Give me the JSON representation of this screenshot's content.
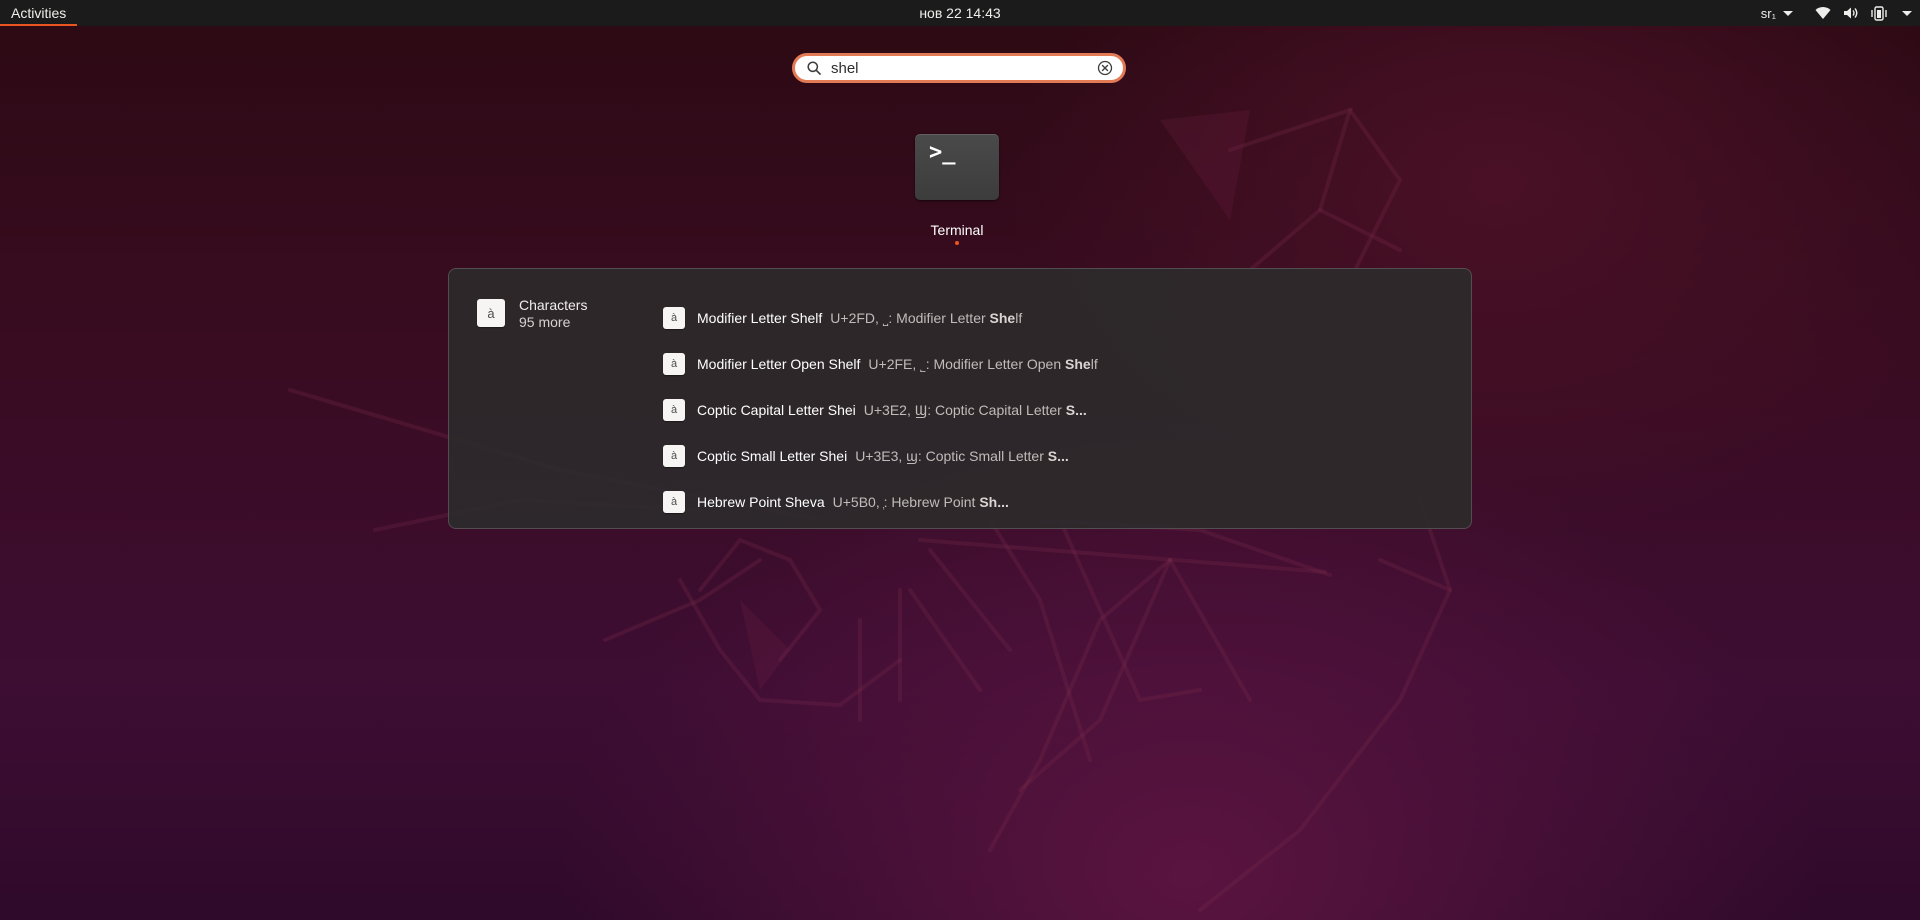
{
  "topbar": {
    "activities": "Activities",
    "clock": "нов 22  14:43",
    "keyboard_layout": "sr₁"
  },
  "search": {
    "value": "shel",
    "icons": {
      "search": "search-icon",
      "clear": "clear-circle-icon"
    }
  },
  "apps": [
    {
      "label": "Terminal",
      "icon_text": ">_",
      "running": true
    }
  ],
  "characters": {
    "provider_name": "Characters",
    "more": "95 more",
    "icon_glyph": "à",
    "results": [
      {
        "title": "Modifier Letter Shelf",
        "desc_prefix": "U+2FD, ˽: Modifier Letter ",
        "desc_bold": "She",
        "desc_suffix": "lf"
      },
      {
        "title": "Modifier Letter Open Shelf",
        "desc_prefix": "U+2FE, ˾: Modifier Letter Open ",
        "desc_bold": "She",
        "desc_suffix": "lf"
      },
      {
        "title": "Coptic Capital Letter Shei",
        "desc_prefix": "U+3E2, Ϣ: Coptic Capital Letter ",
        "desc_bold": "S...",
        "desc_suffix": ""
      },
      {
        "title": "Coptic Small Letter Shei",
        "desc_prefix": "U+3E3, ϣ: Coptic Small Letter ",
        "desc_bold": "S...",
        "desc_suffix": ""
      },
      {
        "title": "Hebrew Point Sheva",
        "desc_prefix": "U+5B0, ְ: Hebrew Point ",
        "desc_bold": "Sh...",
        "desc_suffix": ""
      }
    ]
  }
}
